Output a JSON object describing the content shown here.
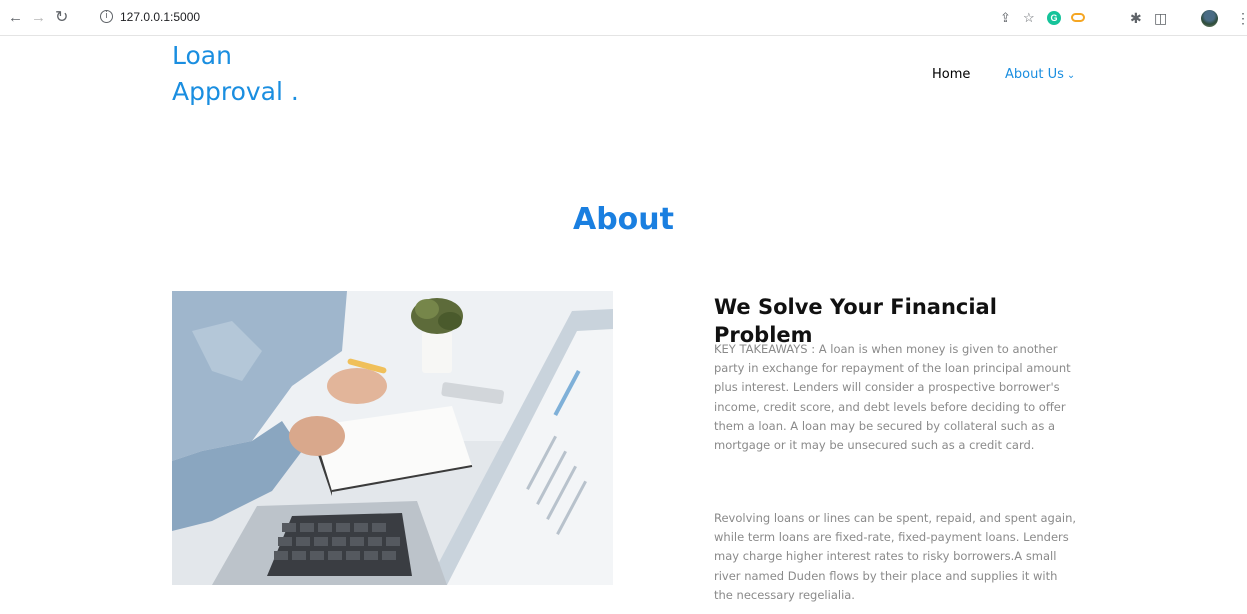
{
  "browser": {
    "url": "127.0.0.1:5000",
    "icons": [
      "back-arrow-icon",
      "forward-arrow-icon",
      "reload-icon",
      "info-icon",
      "share-icon",
      "bookmark-star-icon",
      "grammarly-extension-icon",
      "link-extension-icon",
      "extensions-puzzle-icon",
      "side-panel-icon",
      "profile-avatar",
      "more-menu-icon"
    ]
  },
  "header": {
    "brand_line1": "Loan",
    "brand_line2": "Approval .",
    "nav": {
      "home": "Home",
      "about": "About Us",
      "about_chevron": "⌄"
    }
  },
  "about": {
    "title": "About",
    "heading": "We Solve Your Financial Problem",
    "paragraph1": "KEY TAKEAWAYS : A loan is when money is given to another party in exchange for repayment of the loan principal amount plus interest. Lenders will consider a prospective borrower's income, credit score, and debt levels before deciding to offer them a loan. A loan may be secured by collateral such as a mortgage or it may be unsecured such as a credit card.",
    "paragraph2": "Revolving loans or lines can be spent, repaid, and spent again, while term loans are fixed-rate, fixed-payment loans. Lenders may charge higher interest rates to risky borrowers.A small river named Duden flows by their place and supplies it with the necessary regelialia."
  },
  "colors": {
    "brand_blue": "#1a8ee0",
    "title_blue": "#1a7fe0",
    "body_text": "#8a8a8a"
  }
}
